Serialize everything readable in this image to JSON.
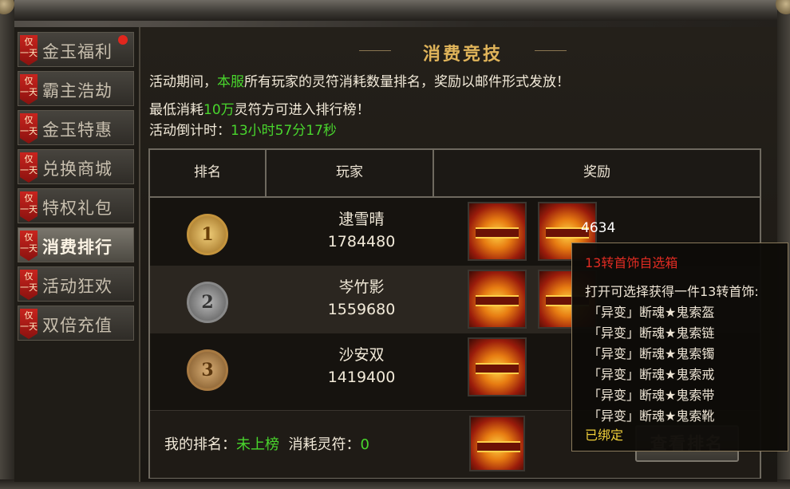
{
  "sidebar": {
    "badge_line1": "仅",
    "badge_line2": "一天",
    "items": [
      {
        "label": "金玉福利"
      },
      {
        "label": "霸主浩劫"
      },
      {
        "label": "金玉特惠"
      },
      {
        "label": "兑换商城"
      },
      {
        "label": "特权礼包"
      },
      {
        "label": "消费排行"
      },
      {
        "label": "活动狂欢"
      },
      {
        "label": "双倍充值"
      }
    ],
    "active_index": 5
  },
  "header": {
    "title": "消费竞技"
  },
  "description": {
    "line1_pre": "活动期间，",
    "line1_highlight": "本服",
    "line1_post": "所有玩家的灵符消耗数量排名，奖励以邮件形式发放！",
    "line2_pre": "最低消耗",
    "line2_highlight": "10万",
    "line2_post": "灵符方可进入排行榜！",
    "countdown_label": "活动倒计时：",
    "countdown_value": "13小时57分17秒"
  },
  "table": {
    "headers": [
      "排名",
      "玩家",
      "奖励"
    ],
    "rows": [
      {
        "rank": "1",
        "name": "逮雪晴",
        "score": "1784480"
      },
      {
        "rank": "2",
        "name": "岑竹影",
        "score": "1559680"
      },
      {
        "rank": "3",
        "name": "沙安双",
        "score": "1419400"
      }
    ],
    "reward_count": "4634"
  },
  "footer": {
    "my_rank_label": "我的排名：",
    "my_rank_value": "未上榜",
    "consumed_label": "消耗灵符：",
    "consumed_value": "0",
    "view_button": "查看排名"
  },
  "tooltip": {
    "title": "13转首饰自选箱",
    "intro": "打开可选择获得一件13转首饰:",
    "items": [
      "「异变」断魂★鬼索盔",
      "「异变」断魂★鬼索链",
      "「异变」断魂★鬼索镯",
      "「异变」断魂★鬼索戒",
      "「异变」断魂★鬼索带",
      "「异变」断魂★鬼索靴"
    ],
    "bound": "已绑定"
  },
  "colors": {
    "highlight_green": "#49d62d",
    "tooltip_title_red": "#e02b22",
    "bound_yellow": "#f0cf3a",
    "notification_red": "#e1261d"
  },
  "icons": [
    "chest-icon",
    "rank-medal-icon",
    "notification-dot-icon",
    "flourish-icon"
  ]
}
